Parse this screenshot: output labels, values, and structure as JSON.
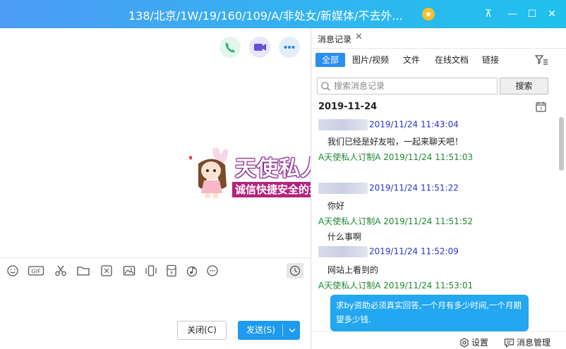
{
  "window": {
    "title": "138/北京/1W/19/160/109/A/非处女/新媒体/不去外...",
    "star_glyph": "★",
    "minimize_glyph": "—",
    "maximize_glyph": "☐",
    "close_glyph": "✕",
    "pin_glyph": "⊼"
  },
  "chat": {
    "actions": [
      "voice-call",
      "video-call",
      "more"
    ],
    "watermark": {
      "title": "天使私人订制",
      "subtitle": "诚信快捷安全的交友平台"
    },
    "toolbar_icons": [
      "emoji-icon",
      "gif-icon",
      "scissors-icon",
      "folder-icon",
      "sticker-icon",
      "image-icon",
      "shake-icon",
      "red-packet-icon",
      "music-icon",
      "more-icon",
      "history-clock-icon"
    ],
    "buttons": {
      "close_label": "关闭(C)",
      "send_label": "发送(S)"
    }
  },
  "history": {
    "tab_label": "消息记录",
    "tab_close": "✕",
    "filters": [
      "全部",
      "图片/视频",
      "文件",
      "在线文档",
      "链接"
    ],
    "active_filter": "全部",
    "search": {
      "placeholder": "搜索消息记录",
      "button_label": "搜索"
    },
    "date": "2019-11-24",
    "messages": [
      {
        "sender": "",
        "time": "2019/11/24 11:43:04",
        "color": "#2434c8",
        "text": "我们已经是好友啦，一起来聊天吧！"
      },
      {
        "sender": "A天使私人订制A",
        "time": "2019/11/24 11:51:03",
        "color": "#1d8a2c",
        "text": ""
      },
      {
        "sender": "",
        "time": "2019/11/24 11:51:22",
        "color": "#2434c8",
        "text": "你好"
      },
      {
        "sender": "A天使私人订制A",
        "time": "2019/11/24 11:51:52",
        "color": "#1d8a2c",
        "text": "什么事啊"
      },
      {
        "sender": "",
        "time": "2019/11/24 11:52:09",
        "color": "#2434c8",
        "text": "网站上看到的"
      },
      {
        "sender": "A天使私人订制A",
        "time": "2019/11/24 11:53:01",
        "color": "#1d8a2c",
        "text": ""
      }
    ],
    "bubble_text": "求by资助必须真实回答,一个月有多少时间,一个月期望多少钱.",
    "footer": {
      "settings_label": "设置",
      "manage_label": "消息管理"
    }
  },
  "colors": {
    "titlebar_start": "#4d9bf5",
    "titlebar_end": "#1fc0ec",
    "accent": "#1e9af0",
    "sender_self": "#2434c8",
    "sender_other": "#1d8a2c",
    "watermark_band": "#b4237d"
  }
}
